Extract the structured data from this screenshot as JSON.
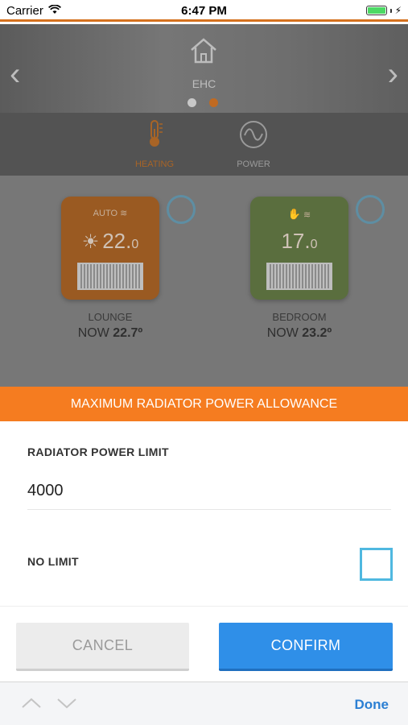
{
  "status_bar": {
    "carrier": "Carrier",
    "time": "6:47 PM"
  },
  "header": {
    "title": "EHC"
  },
  "tabs": [
    {
      "label": "HEATING",
      "active": true
    },
    {
      "label": "POWER",
      "active": false
    }
  ],
  "devices": [
    {
      "mode": "AUTO",
      "setpoint": "22.",
      "setpoint_decimal": "0",
      "name": "LOUNGE",
      "now_prefix": "NOW",
      "now_value": "22.7º"
    },
    {
      "mode": "",
      "setpoint": "17.",
      "setpoint_decimal": "0",
      "name": "BEDROOM",
      "now_prefix": "NOW",
      "now_value": "23.2º"
    }
  ],
  "modal": {
    "title": "MAXIMUM RADIATOR POWER ALLOWANCE",
    "power_limit_label": "RADIATOR POWER LIMIT",
    "power_limit_value": "4000",
    "no_limit_label": "NO LIMIT",
    "no_limit_checked": false,
    "cancel_label": "CANCEL",
    "confirm_label": "CONFIRM"
  },
  "keyboard_accessory": {
    "done_label": "Done"
  },
  "colors": {
    "accent": "#f57c20",
    "confirm": "#2f8fe8",
    "checkbox": "#4fb8e0",
    "done": "#2b7fd3"
  }
}
